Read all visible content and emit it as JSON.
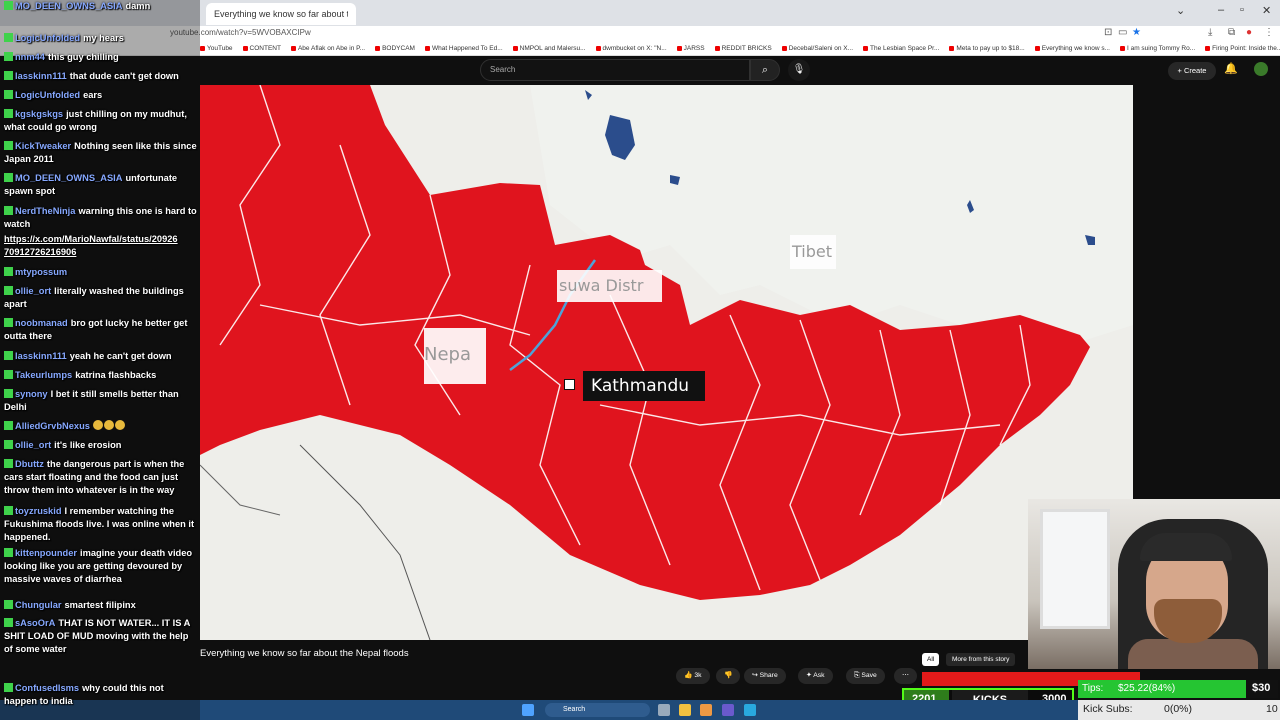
{
  "browser": {
    "url": "youtube.com/watch?v=5WVOBAXCIPw",
    "bookmarks": [
      "YouTube",
      "CONTENT",
      "Abe Aflak on Abe in P...",
      "BODYCAM",
      "What Happened To Ed...",
      "NMPOL and Malersu...",
      "dwmbucket on X: \"N...",
      "JARSS",
      "REDDIT BRICKS",
      "Decebal/Saleni on X...",
      "The Lesbian Space Pr...",
      "Meta to pay up to $18...",
      "Everything we know s...",
      "I am suing Tommy Ro...",
      "Firing Point: Inside the..."
    ]
  },
  "youtube": {
    "search_placeholder": "Search",
    "search_icon": "magnifier-icon",
    "mic_icon": "mic-icon",
    "create_label": "Create",
    "video_title": "Everything we know so far about the Nepal floods",
    "actions": {
      "likes": "3k",
      "share": "Share",
      "ask": "Ask",
      "save": "Save"
    },
    "chips": {
      "all": "All",
      "more": "More from this story"
    }
  },
  "map": {
    "labels": {
      "tibet": "Tibet",
      "district": "suwa Distr",
      "nepal": "Nepa",
      "capital": "Kathmandu"
    },
    "colors": {
      "flood_region": "#e0141e",
      "land": "#eeeeea",
      "water": "#2b4d8c",
      "border": "#ffffff"
    }
  },
  "chat": {
    "messages": [
      {
        "user": "MO_DEEN_OWNS_ASIA",
        "text": "damn"
      },
      {
        "user": "LogicUnfolded",
        "text": "my hears"
      },
      {
        "user": "nnm44",
        "text": "this guy chilling"
      },
      {
        "user": "lasskinn111",
        "text": "that dude can't get down"
      },
      {
        "user": "LogicUnfolded",
        "text": "ears"
      },
      {
        "user": "kgskgskgs",
        "text": "just chilling on my mudhut, what could go wrong"
      },
      {
        "user": "KickTweaker",
        "text": "Nothing seen like this since Japan 2011"
      },
      {
        "user": "MO_DEEN_OWNS_ASIA",
        "text": "unfortunate spawn spot"
      },
      {
        "user": "NerdTheNinja",
        "text": "warning this one is hard to watch"
      },
      {
        "user": "",
        "text": "https://x.com/MarioNawfal/status/20926 70912726216906"
      },
      {
        "user": "mtypossum",
        "text": ""
      },
      {
        "user": "ollie_ort",
        "text": "literally washed the buildings apart"
      },
      {
        "user": "noobmanad",
        "text": "bro got lucky he better get outta there"
      },
      {
        "user": "lasskinn111",
        "text": "yeah he can't get down"
      },
      {
        "user": "Takeurlumps",
        "text": "katrina flashbacks"
      },
      {
        "user": "synony",
        "text": "I bet it still smells better than Delhi"
      },
      {
        "user": "AlliedGrvbNexus",
        "text": ""
      },
      {
        "user": "ollie_ort",
        "text": "it's like erosion"
      },
      {
        "user": "Dbuttz",
        "text": "the dangerous part is when the cars start floating and the food can just throw them into whatever is in the way"
      },
      {
        "user": "toyzruskid",
        "text": "I remember watching the Fukushima floods live. I was online when it happened."
      },
      {
        "user": "kittenpounder",
        "text": "imagine your death video looking like you are getting devoured by massive waves of diarrhea"
      },
      {
        "user": "Chungular",
        "text": "smartest filipinx"
      },
      {
        "user": "sAsoOrA",
        "text": "THAT IS NOT WATER... IT IS A SHIT LOAD OF MUD moving with the help of some water"
      },
      {
        "user": "ConfusedIsms",
        "text": "why could this not happen to india"
      }
    ],
    "badge_color": "#3fd24b",
    "user_color": "#86a8ff"
  },
  "widgets": {
    "kick_count": "2201",
    "kick_label": "KICKS",
    "kick_goal": "3000",
    "kick_progress": 0.73,
    "tips_label": "Tips:",
    "tips_amount": "$25.22(84%)",
    "tips_goal": "$30",
    "tips_progress": 0.84,
    "subs_label": "Kick Subs:",
    "subs_value": "0(0%)",
    "subs_goal": "10",
    "accent": "#53fc18"
  },
  "taskbar": {
    "search_label": "Search"
  }
}
